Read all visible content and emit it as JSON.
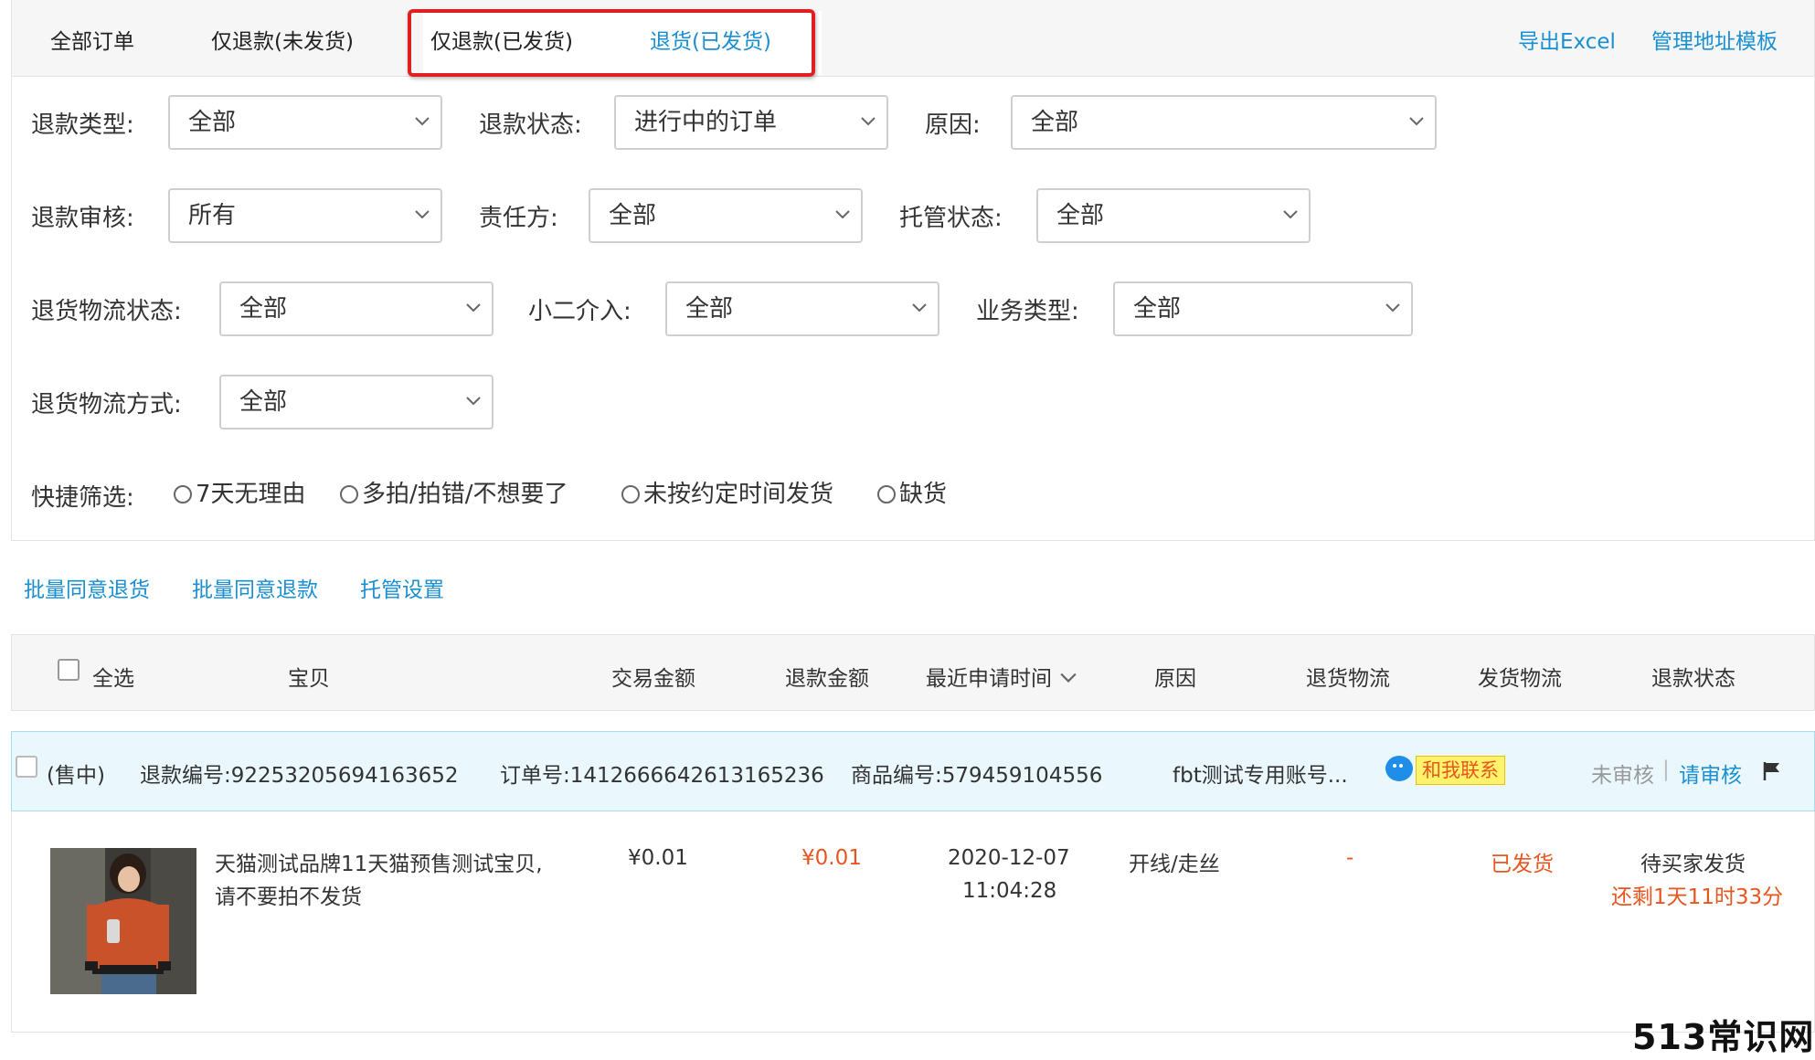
{
  "tabs": {
    "all": "全部订单",
    "refund_unshipped": "仅退款(未发货)",
    "refund_shipped": "仅退款(已发货)",
    "return_shipped": "退货(已发货)"
  },
  "top_links": {
    "export": "导出Excel",
    "address": "管理地址模板"
  },
  "filters": {
    "refund_type": {
      "label": "退款类型:",
      "value": "全部"
    },
    "refund_status": {
      "label": "退款状态:",
      "value": "进行中的订单"
    },
    "reason": {
      "label": "原因:",
      "value": "全部"
    },
    "refund_review": {
      "label": "退款审核:",
      "value": "所有"
    },
    "responsible": {
      "label": "责任方:",
      "value": "全部"
    },
    "custody_status": {
      "label": "托管状态:",
      "value": "全部"
    },
    "return_logistics_status": {
      "label": "退货物流状态:",
      "value": "全部"
    },
    "xiaoer": {
      "label": "小二介入:",
      "value": "全部"
    },
    "business_type": {
      "label": "业务类型:",
      "value": "全部"
    },
    "return_logistics_method": {
      "label": "退货物流方式:",
      "value": "全部"
    }
  },
  "quick_filter": {
    "label": "快捷筛选:",
    "options": [
      "7天无理由",
      "多拍/拍错/不想要了",
      "未按约定时间发货",
      "缺货"
    ]
  },
  "batch_actions": {
    "agree_return": "批量同意退货",
    "agree_refund": "批量同意退款",
    "custody": "托管设置"
  },
  "table_headers": {
    "select_all": "全选",
    "item": "宝贝",
    "trade_amount": "交易金额",
    "refund_amount": "退款金额",
    "recent_time": "最近申请时间",
    "reason": "原因",
    "return_logistics": "退货物流",
    "ship_logistics": "发货物流",
    "refund_status": "退款状态"
  },
  "order": {
    "sale_status": "(售中)",
    "refund_no": "退款编号:92253205694163652",
    "order_no": "订单号:1412666642613165236",
    "product_no": "商品编号:579459104556",
    "account": "fbt测试专用账号...",
    "contact": "和我联系",
    "review_status": "未审核",
    "separator": "|",
    "review_link": "请审核"
  },
  "product": {
    "title_line1": "天猫测试品牌11天猫预售测试宝贝,",
    "title_line2": "请不要拍不发货",
    "trade_amount": "¥0.01",
    "refund_amount": "¥0.01",
    "date": "2020-12-07",
    "time": "11:04:28",
    "reason": "开线/走丝",
    "return_logistics": "-",
    "ship_logistics": "已发货",
    "refund_status": "待买家发货",
    "countdown": "还剩1天11时33分"
  },
  "watermark": "513常识网",
  "colors": {
    "link": "#1a8fd1",
    "accent_red": "#e8561f",
    "highlight": "#e02020"
  }
}
